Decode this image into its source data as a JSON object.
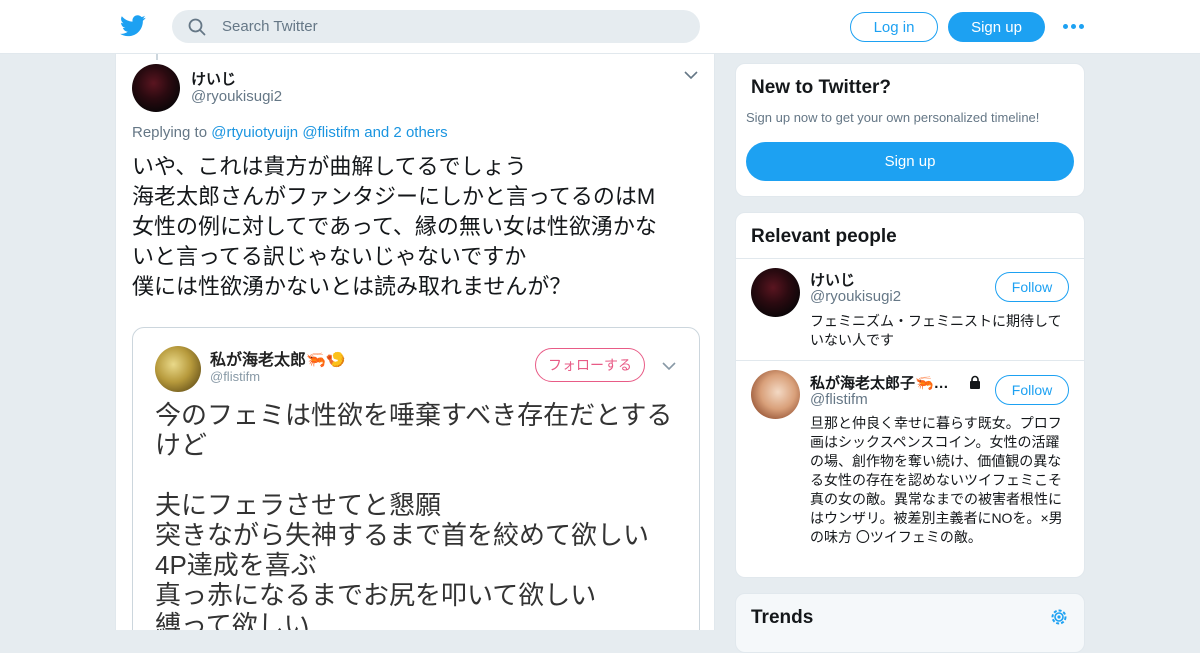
{
  "topbar": {
    "logo_icon": "twitter-bird-icon",
    "search_placeholder": "Search Twitter",
    "login_label": "Log in",
    "signup_label": "Sign up",
    "more_icon": "more-dots-icon",
    "accent_color": "#1da1f2"
  },
  "tweet": {
    "author_name": "けいじ",
    "author_handle": "@ryoukisugi2",
    "replying_prefix": "Replying to",
    "replying_user1": "@rtyuiotyuijn",
    "replying_user2": "@flistifm",
    "replying_others": "and 2 others",
    "lines": [
      "いや、これは貴方が曲解してるでしょう",
      "海老太郎さんがファンタジーにしかと言ってるのはM",
      "女性の例に対してであって、縁の無い女は性欲湧かな",
      "いと言ってる訳じゃないじゃないですか",
      "僕には性欲湧かないとは読み取れませんが？"
    ],
    "quoted": {
      "name": "私が海老太郎🦐🍤",
      "handle": "@flistifm",
      "follow_label": "フォローする",
      "lines": [
        "今のフェミは性欲を唾棄すべき存在だとする",
        "けど",
        "",
        "夫にフェラさせてと懇願",
        "突きながら失神するまで首を絞めて欲しい",
        "4P達成を喜ぶ",
        "真っ赤になるまでお尻を叩いて欲しい",
        "縛って欲しい"
      ]
    }
  },
  "sidebar": {
    "new_box": {
      "title": "New to Twitter?",
      "subtitle": "Sign up now to get your own personalized timeline!",
      "button": "Sign up"
    },
    "relevant": {
      "title": "Relevant people",
      "people": [
        {
          "name": "けいじ",
          "handle": "@ryoukisugi2",
          "follow": "Follow",
          "bio": "フェミニズム・フェミニストに期待していない人です"
        },
        {
          "name": "私が海老太郎子🦐…",
          "handle": "@flistifm",
          "follow": "Follow",
          "bio": "旦那と仲良く幸せに暮らす既女。プロフ画はシックスペンスコイン。女性の活躍の場、創作物を奪い続け、価値観の異なる女性の存在を認めないツイフェミこそ真の女の敵。異常なまでの被害者根性にはウンザリ。被差別主義者にNOを。×男の味方 〇ツイフェミの敵。"
        }
      ]
    },
    "trends": {
      "title": "Trends",
      "settings_icon": "gear-icon"
    }
  }
}
